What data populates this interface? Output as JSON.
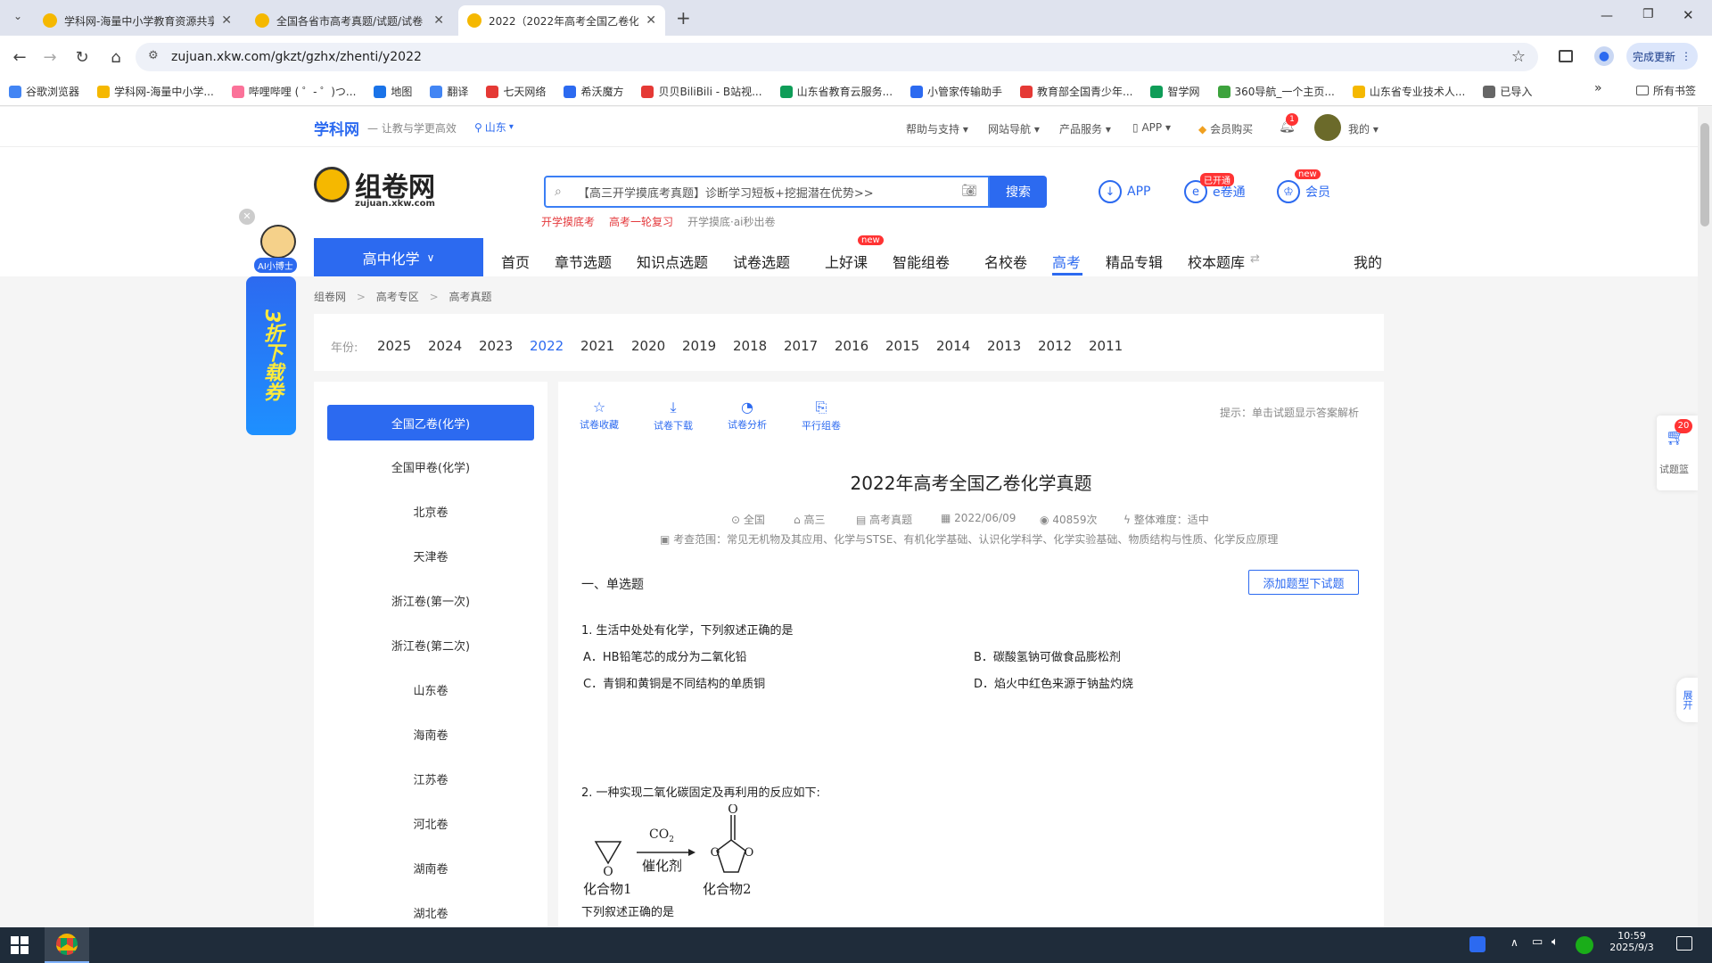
{
  "browser": {
    "tabs": [
      {
        "title": "学科网-海量中小学教育资源共享",
        "active": false
      },
      {
        "title": "全国各省市高考真题/试题/试卷",
        "active": false
      },
      {
        "title": "2022（2022年高考全国乙卷化",
        "active": true
      }
    ],
    "url": "zujuan.xkw.com/gkzt/gzhx/zhenti/y2022",
    "update_button": "完成更新",
    "bookmarks": [
      "谷歌浏览器",
      "学科网-海量中小学...",
      "哔哩哔哩 ( ゜- ゜)つ...",
      "地图",
      "翻译",
      "七天网络",
      "希沃魔方",
      "贝贝BiliBili - B站视...",
      "山东省教育云服务...",
      "小管家传输助手",
      "教育部全国青少年...",
      "智学网",
      "360导航_一个主页...",
      "山东省专业技术人...",
      "已导入"
    ],
    "all_bookmarks": "所有书签",
    "more_bookmarks": "»"
  },
  "site_top": {
    "brand": "学科网",
    "slogan": "— 让教与学更高效",
    "region": "山东",
    "links": [
      "帮助与支持",
      "网站导航",
      "产品服务",
      "APP",
      "会员购买"
    ],
    "notif_count": "1",
    "user": "我的"
  },
  "header": {
    "logo_text": "组卷网",
    "logo_sub": "zujuan.xkw.com",
    "search_placeholder": "【高三开学摸底考真题】诊断学习短板+挖掘潜在优势>>",
    "search_button": "搜索",
    "hot_words": [
      "开学摸底考",
      "高考一轮复习",
      "开学摸底·ai秒出卷"
    ],
    "right": [
      {
        "label": "APP",
        "badge": ""
      },
      {
        "label": "e卷通",
        "badge": "已开通"
      },
      {
        "label": "会员",
        "badge": "new"
      }
    ]
  },
  "ai_float": {
    "label": "AI小博士",
    "promo": "3折下载券"
  },
  "nav": {
    "subject": "高中化学",
    "items": [
      "首页",
      "章节选题",
      "知识点选题",
      "试卷选题",
      "上好课",
      "智能组卷",
      "名校卷",
      "高考",
      "精品专辑",
      "校本题库"
    ],
    "new_badge": "new",
    "active": "高考",
    "mine": "我的"
  },
  "breadcrumb": [
    "组卷网",
    "高考专区",
    "高考真题"
  ],
  "years": {
    "label": "年份:",
    "items": [
      "2025",
      "2024",
      "2023",
      "2022",
      "2021",
      "2020",
      "2019",
      "2018",
      "2017",
      "2016",
      "2015",
      "2014",
      "2013",
      "2012",
      "2011"
    ],
    "active": "2022"
  },
  "papers": [
    "全国乙卷(化学)",
    "全国甲卷(化学)",
    "北京卷",
    "天津卷",
    "浙江卷(第一次)",
    "浙江卷(第二次)",
    "山东卷",
    "海南卷",
    "江苏卷",
    "河北卷",
    "湖南卷",
    "湖北卷"
  ],
  "tools": [
    "试卷收藏",
    "试卷下载",
    "试卷分析",
    "平行组卷"
  ],
  "hint": "提示：单击试题显示答案解析",
  "paper": {
    "title": "2022年高考全国乙卷化学真题",
    "meta": [
      "全国",
      "高三",
      "高考真题",
      "2022/06/09",
      "40859次",
      "整体难度：适中"
    ],
    "scope": "考查范围：常见无机物及其应用、化学与STSE、有机化学基础、认识化学科学、化学实验基础、物质结构与性质、化学反应原理",
    "section": "一、单选题",
    "add_button": "添加题型下试题",
    "q1": {
      "stem": "1. 生活中处处有化学，下列叙述正确的是",
      "options": [
        "A．HB铅笔芯的成分为二氧化铅",
        "B．碳酸氢钠可做食品膨松剂",
        "C．青铜和黄铜是不同结构的单质铜",
        "D．焰火中红色来源于钠盐灼烧"
      ]
    },
    "q2": {
      "stem": "2. 一种实现二氧化碳固定及再利用的反应如下:",
      "co2": "CO",
      "co2_sub": "2",
      "catalyst": "催化剂",
      "compound1": "化合物1",
      "compound2": "化合物2",
      "tail": "下列叙述正确的是"
    }
  },
  "right_float": {
    "cart_count": "20",
    "cart_label": "试题篮",
    "expand": "展开"
  },
  "taskbar": {
    "time": "10:59",
    "date": "2025/9/3"
  }
}
